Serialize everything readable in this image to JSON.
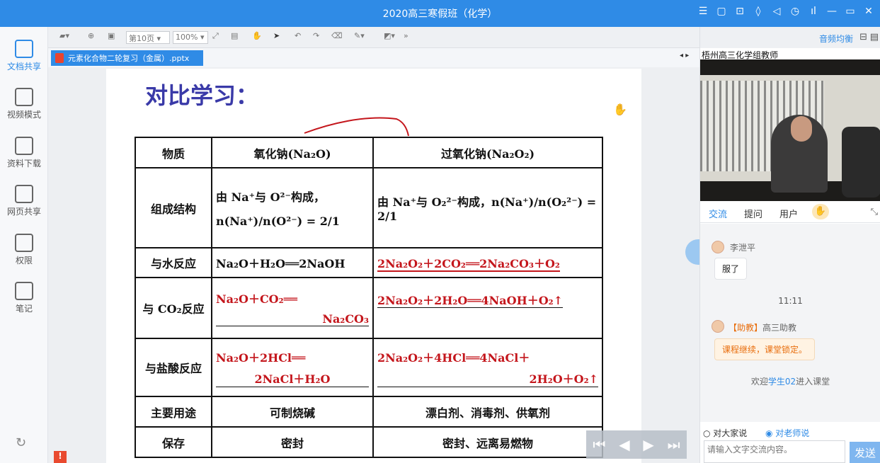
{
  "window": {
    "title": "2020高三寒假班（化学）"
  },
  "sidebar": {
    "items": [
      {
        "label": "文档共享",
        "icon": "document-share-icon",
        "active": true
      },
      {
        "label": "视频模式",
        "icon": "video-mode-icon"
      },
      {
        "label": "资料下载",
        "icon": "download-icon"
      },
      {
        "label": "网页共享",
        "icon": "web-share-icon"
      },
      {
        "label": "权限",
        "icon": "permission-icon"
      },
      {
        "label": "笔记",
        "icon": "note-icon"
      }
    ]
  },
  "toolbar": {
    "page_select": "第10页",
    "zoom_select": "100%"
  },
  "doc": {
    "tab_name": "元素化合物二轮复习（金属）.pptx"
  },
  "slide": {
    "title": "对比学习：",
    "table": {
      "header": [
        "物质",
        "氧化钠(Na₂O)",
        "过氧化钠(Na₂O₂)"
      ],
      "rows": [
        {
          "label": "组成结构",
          "c1a": "由 Na⁺与 O²⁻构成，",
          "c1b": "n(Na⁺)/n(O²⁻) = 2/1",
          "c2": "由 Na⁺与 O₂²⁻构成，n(Na⁺)/n(O₂²⁻) = 2/1"
        },
        {
          "label": "与水反应",
          "c1": "Na₂O＋H₂O══2NaOH",
          "c2": "2Na₂O₂＋2CO₂══2Na₂CO₃＋O₂"
        },
        {
          "label": "与 CO₂反应",
          "c1a": "Na₂O＋CO₂══",
          "c1b": "Na₂CO₃",
          "c2": "2Na₂O₂＋2H₂O══4NaOH＋O₂↑"
        },
        {
          "label": "与盐酸反应",
          "c1a": "Na₂O＋2HCl══",
          "c1b": "2NaCl＋H₂O",
          "c2a": "2Na₂O₂＋4HCl══4NaCl＋",
          "c2b": "2H₂O＋O₂↑"
        },
        {
          "label": "主要用途",
          "c1": "可制烧碱",
          "c2": "漂白剂、消毒剂、供氧剂"
        },
        {
          "label": "保存",
          "c1": "密封",
          "c2": "密封、远离易燃物"
        }
      ]
    }
  },
  "right": {
    "balance_label": "音频均衡",
    "video_label": "梧州高三化学组教师",
    "tabs": [
      "交流",
      "提问",
      "用户"
    ],
    "chat": {
      "msg1_name": "李泄平",
      "msg1_text": "服了",
      "time": "11:11",
      "msg2_role": "【助教】",
      "msg2_name": "高三助教",
      "msg2_text": "课程继续，课堂锁定。",
      "sys_prefix": "欢迎",
      "sys_user": "学生02",
      "sys_suffix": "进入课堂"
    },
    "radio_all": "对大家说",
    "radio_teacher": "对老师说",
    "input_placeholder": "请输入文字交流内容。",
    "send_label": "发送"
  },
  "colors": {
    "accent": "#2f8be6",
    "ink_red": "#c4161c",
    "title_blue": "#3a3aa8"
  }
}
